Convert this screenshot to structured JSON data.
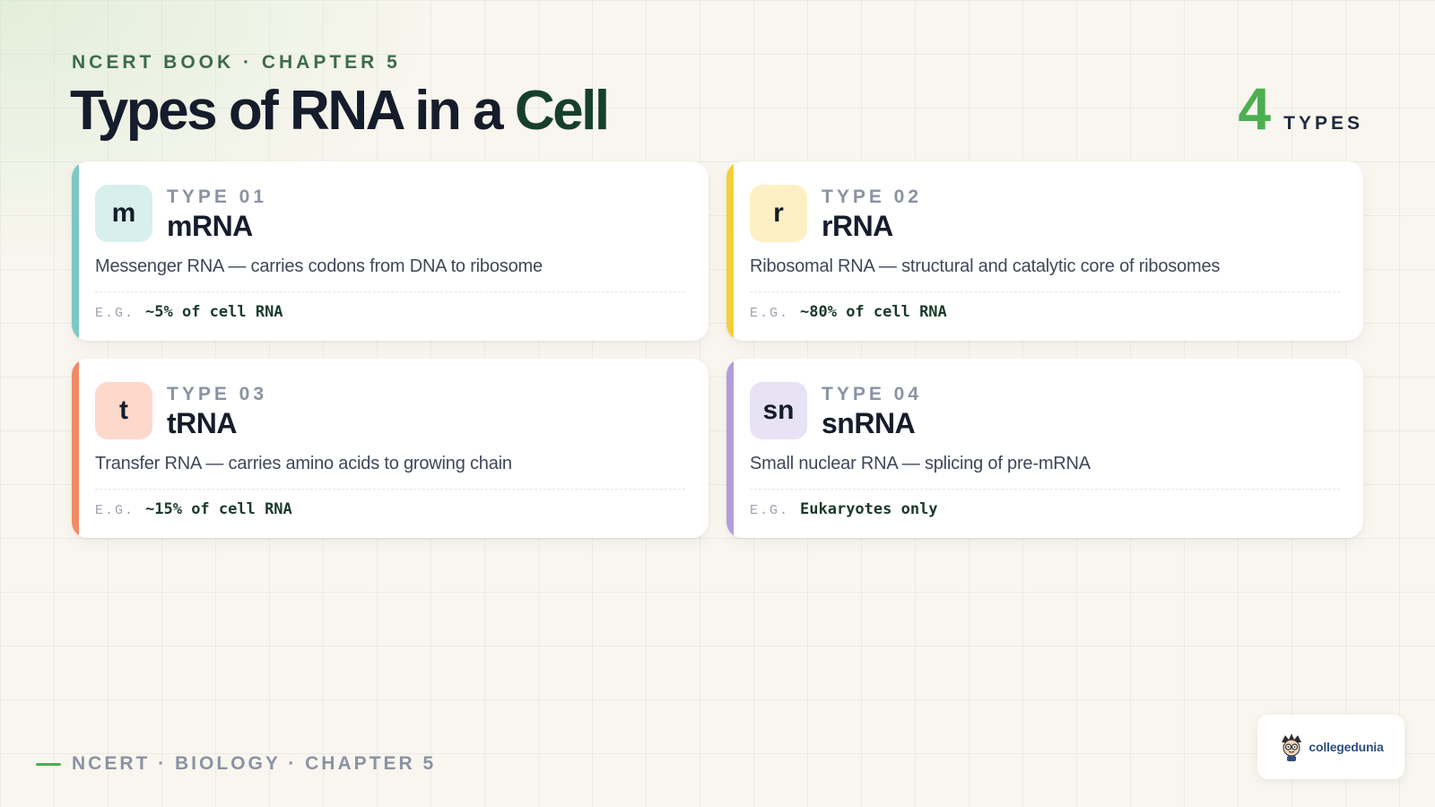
{
  "header": {
    "eyebrow": "NCERT BOOK · CHAPTER 5",
    "title_main": "Types of RNA in a ",
    "title_accent": "Cell",
    "count_number": "4",
    "count_label": "TYPES"
  },
  "cards": [
    {
      "badge": "m",
      "type_label": "TYPE 01",
      "name": "mRNA",
      "description": "Messenger RNA — carries codons from DNA to ribosome",
      "eg_label": "E.G.",
      "eg_value": "~5% of cell RNA",
      "accent_color": "#7ec8c3",
      "badge_bg": "#d8efed"
    },
    {
      "badge": "r",
      "type_label": "TYPE 02",
      "name": "rRNA",
      "description": "Ribosomal RNA — structural and catalytic core of ribosomes",
      "eg_label": "E.G.",
      "eg_value": "~80% of cell RNA",
      "accent_color": "#f5cf3a",
      "badge_bg": "#fdf0c4"
    },
    {
      "badge": "t",
      "type_label": "TYPE 03",
      "name": "tRNA",
      "description": "Transfer RNA — carries amino acids to growing chain",
      "eg_label": "E.G.",
      "eg_value": "~15% of cell RNA",
      "accent_color": "#f28a63",
      "badge_bg": "#fdd9cc"
    },
    {
      "badge": "sn",
      "type_label": "TYPE 04",
      "name": "snRNA",
      "description": "Small nuclear RNA — splicing of pre-mRNA",
      "eg_label": "E.G.",
      "eg_value": "Eukaryotes only",
      "accent_color": "#b39ddb",
      "badge_bg": "#e8e2f5"
    }
  ],
  "footer": {
    "text": "NCERT · BIOLOGY · CHAPTER 5"
  },
  "logo": {
    "brand": "collegedunia",
    "icon": "mascot-icon"
  },
  "colors": {
    "green_accent": "#4caf50",
    "title_accent": "#17402a"
  }
}
